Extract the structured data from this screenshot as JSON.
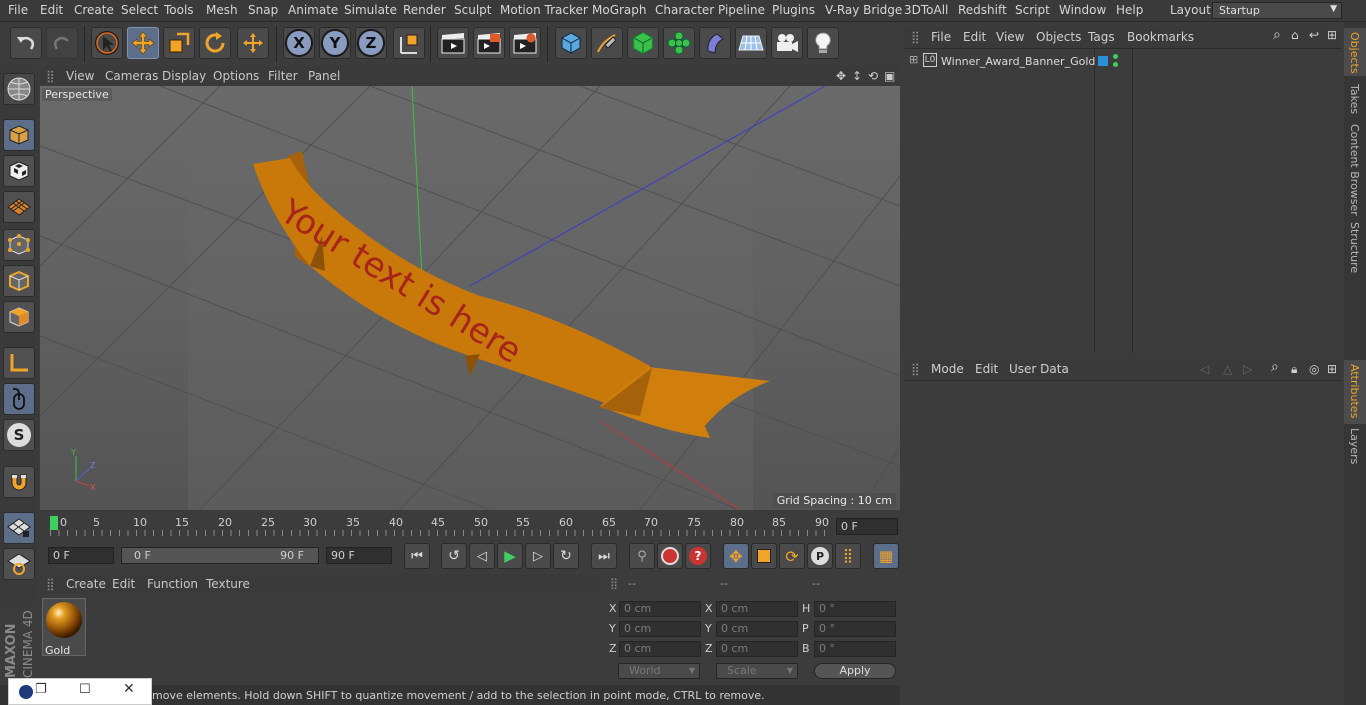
{
  "menubar": [
    "File",
    "Edit",
    "Create",
    "Select",
    "Tools",
    "Mesh",
    "Snap",
    "Animate",
    "Simulate",
    "Render",
    "Sculpt",
    "Motion Tracker",
    "MoGraph",
    "Character",
    "Pipeline",
    "Plugins",
    "V-Ray Bridge",
    "3DToAll",
    "Redshift",
    "Script",
    "Window",
    "Help"
  ],
  "layout": {
    "label": "Layout:",
    "value": "Startup"
  },
  "viewport": {
    "menu": [
      "View",
      "Cameras",
      "Display",
      "Options",
      "Filter",
      "Panel"
    ],
    "label": "Perspective",
    "grid_spacing": "Grid Spacing : 10 cm",
    "banner_text": "Your text is here"
  },
  "timeline": {
    "ticks": [
      "0",
      "5",
      "10",
      "15",
      "20",
      "25",
      "30",
      "35",
      "40",
      "45",
      "50",
      "55",
      "60",
      "65",
      "70",
      "75",
      "80",
      "85",
      "90"
    ],
    "current_frame": "0 F",
    "start": "0 F",
    "range_start": "0 F",
    "range_end": "90 F",
    "end": "90 F"
  },
  "material": {
    "menu": [
      "Create",
      "Edit",
      "Function",
      "Texture"
    ],
    "name": "Gold"
  },
  "coords": {
    "headers": [
      "--",
      "--",
      "--"
    ],
    "rows": [
      {
        "l1": "X",
        "v1": "0 cm",
        "l2": "X",
        "v2": "0 cm",
        "l3": "H",
        "v3": "0 °"
      },
      {
        "l1": "Y",
        "v1": "0 cm",
        "l2": "Y",
        "v2": "0 cm",
        "l3": "P",
        "v3": "0 °"
      },
      {
        "l1": "Z",
        "v1": "0 cm",
        "l2": "Z",
        "v2": "0 cm",
        "l3": "B",
        "v3": "0 °"
      }
    ],
    "world": "World",
    "scale": "Scale",
    "apply": "Apply"
  },
  "status": "move elements. Hold down SHIFT to quantize movement / add to the selection in point mode, CTRL to remove.",
  "objects": {
    "menu": [
      "File",
      "Edit",
      "View",
      "Objects",
      "Tags",
      "Bookmarks"
    ],
    "item": "Winner_Award_Banner_Gold"
  },
  "attributes": {
    "menu": [
      "Mode",
      "Edit",
      "User Data"
    ]
  },
  "right_tabs": [
    "Objects",
    "Takes",
    "Content Browser",
    "Structure",
    "Attributes",
    "Layers"
  ],
  "brand": {
    "line1": "MAXON",
    "line2": "CINEMA 4D"
  },
  "colors": {
    "accent": "#f0a42a",
    "banner": "#c9780a",
    "banner_text": "#a8231b"
  }
}
